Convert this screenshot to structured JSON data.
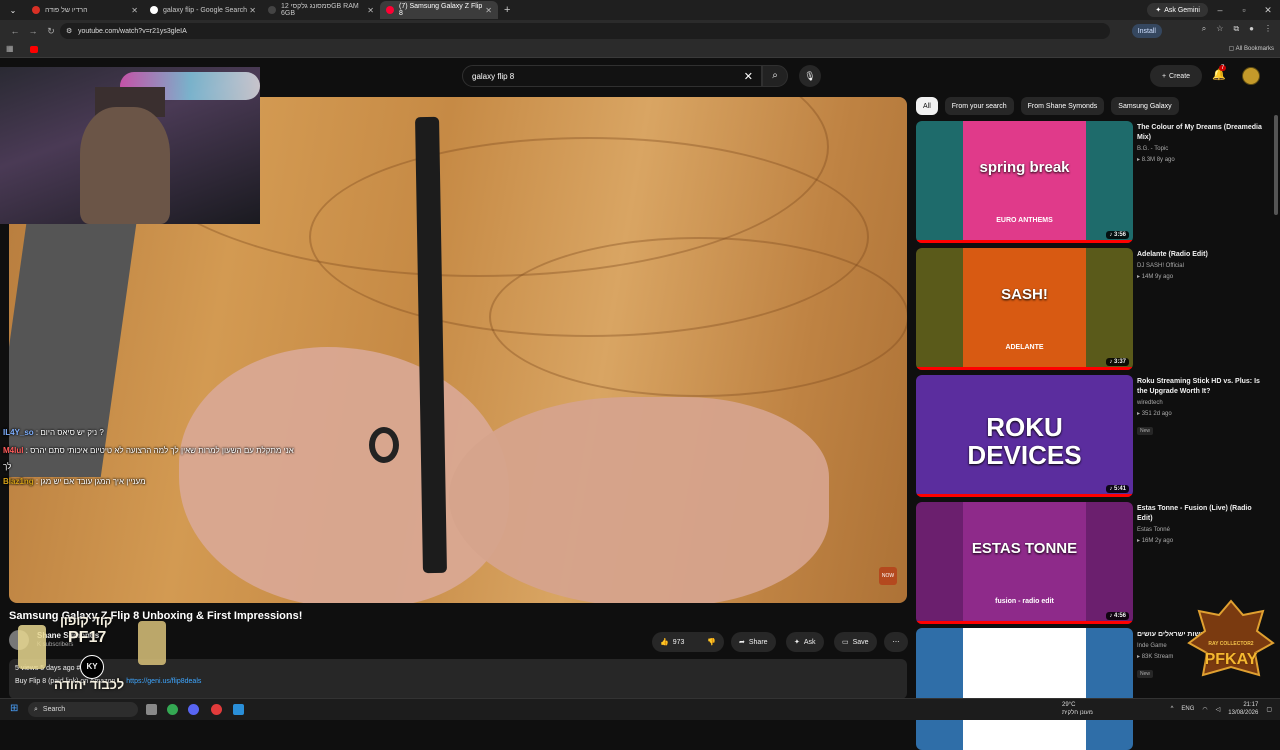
{
  "browser": {
    "tabs": [
      {
        "label": "הרדיו של פודה",
        "favicon_color": "#d93025"
      },
      {
        "label": "galaxy flip - Google Search",
        "favicon_color": "#ffffff"
      },
      {
        "label": "סמסונג גלקסי 12GB RAM 6GB",
        "favicon_color": "#444444"
      },
      {
        "label": "(7) Samsung Galaxy Z Flip 8",
        "favicon_color": "#ff0033",
        "active": true
      }
    ],
    "ask_gemini": "Ask Gemini",
    "url": "youtube.com/watch?v=r21ys3gleIA",
    "install": "Install",
    "all_bookmarks": "All Bookmarks"
  },
  "youtube": {
    "search_value": "galaxy flip 8",
    "create_label": "Create",
    "notifications_count": "7",
    "video_title": "Samsung Galaxy Z Flip 8 Unboxing & First Impressions!",
    "channel_name": "Shane Symonds",
    "channel_subs": "K subscribers",
    "like_count": "973",
    "share_label": "Share",
    "ask_label": "Ask",
    "save_label": "Save",
    "desc_line1": "5 views  5 days ago  #product",
    "desc_line2": "Buy Flip 8 (paid link) on Amazon →",
    "desc_link": "https://geni.us/flip8deals",
    "chips": [
      "All",
      "From your search",
      "From Shane Symonds",
      "Samsung Galaxy"
    ],
    "recommendations": [
      {
        "title": "The Colour of My Dreams (Dreamedia Mix)",
        "channel": "B.G. - Topic",
        "meta": "8.3M  8y ago",
        "duration": "3:56",
        "art_text": "spring break",
        "art_sub": "EURO ANTHEMS",
        "bg": "#1e6b6b",
        "art": "#e03a8a",
        "progress": 1.0
      },
      {
        "title": "Adelante (Radio Edit)",
        "channel": "DJ SASH! Official",
        "meta": "14M  9y ago",
        "duration": "3:37",
        "art_text": "SASH!",
        "art_sub": "ADELANTE",
        "bg": "#5a5a1a",
        "art": "#d85a12",
        "progress": 1.0
      },
      {
        "title": "Roku Streaming Stick HD vs. Plus: Is the Upgrade Worth It?",
        "channel": "wiredtech",
        "meta": "351  2d ago",
        "duration": "5:41",
        "art_text": "ROKU DEVICES",
        "art_sub": "",
        "bg": "#5b2d9e",
        "art": "#5b2d9e",
        "badge": "New",
        "progress": 1.0
      },
      {
        "title": "Estas Tonne - Fusion (Live) (Radio Edit)",
        "channel": "Estas Tonné",
        "meta": "16M  2y ago",
        "duration": "4:56",
        "art_text": "ESTAS TONNE",
        "art_sub": "fusion - radio edit",
        "bg": "#6b1f6e",
        "art": "#8e2a8a",
        "progress": 1.0
      },
      {
        "title": "מה כבר אפשר לעשות ישראלים עושים?",
        "channel": "Inde Game",
        "meta": "83K  Stream",
        "duration": "",
        "art_text": "",
        "art_sub": "",
        "bg": "#2f6ea8",
        "art": "#ffffff",
        "badge": "New",
        "progress": 0.0
      }
    ]
  },
  "overlay": {
    "chat": [
      {
        "user": "IL4Y_so",
        "user_color": "#7fb0ff",
        "text": "ניק יש סיאס היום ?"
      },
      {
        "user": "M4lul",
        "user_color": "#ff5a5a",
        "text": "אני מתקלת עם השעון למרות שאין לך למה הרצועה לא טיטיום איכותי סתם יהרס"
      },
      {
        "user": "",
        "user_color": "#ffffff",
        "text": "לך"
      },
      {
        "user": "Blaz1ng",
        "user_color": "#d4a017",
        "text": "מעניין איך המגן עובד אם יש מגן"
      }
    ],
    "promo_line1": "קוד קופון",
    "promo_code": "PF17",
    "promo_line2": "לכבוד יהודה",
    "promo_ky": "KY",
    "badge_text": "PFKAY",
    "badge_sub": "RAY COLLECTOR2"
  },
  "taskbar": {
    "search": "Search",
    "weather_temp": "29°C",
    "weather_desc": "מעונן חלקית",
    "lang": "ENG",
    "time": "21:17",
    "date": "13/08/2026"
  },
  "colors": {
    "accent_red": "#ff0000",
    "link_blue": "#3ea6ff"
  }
}
